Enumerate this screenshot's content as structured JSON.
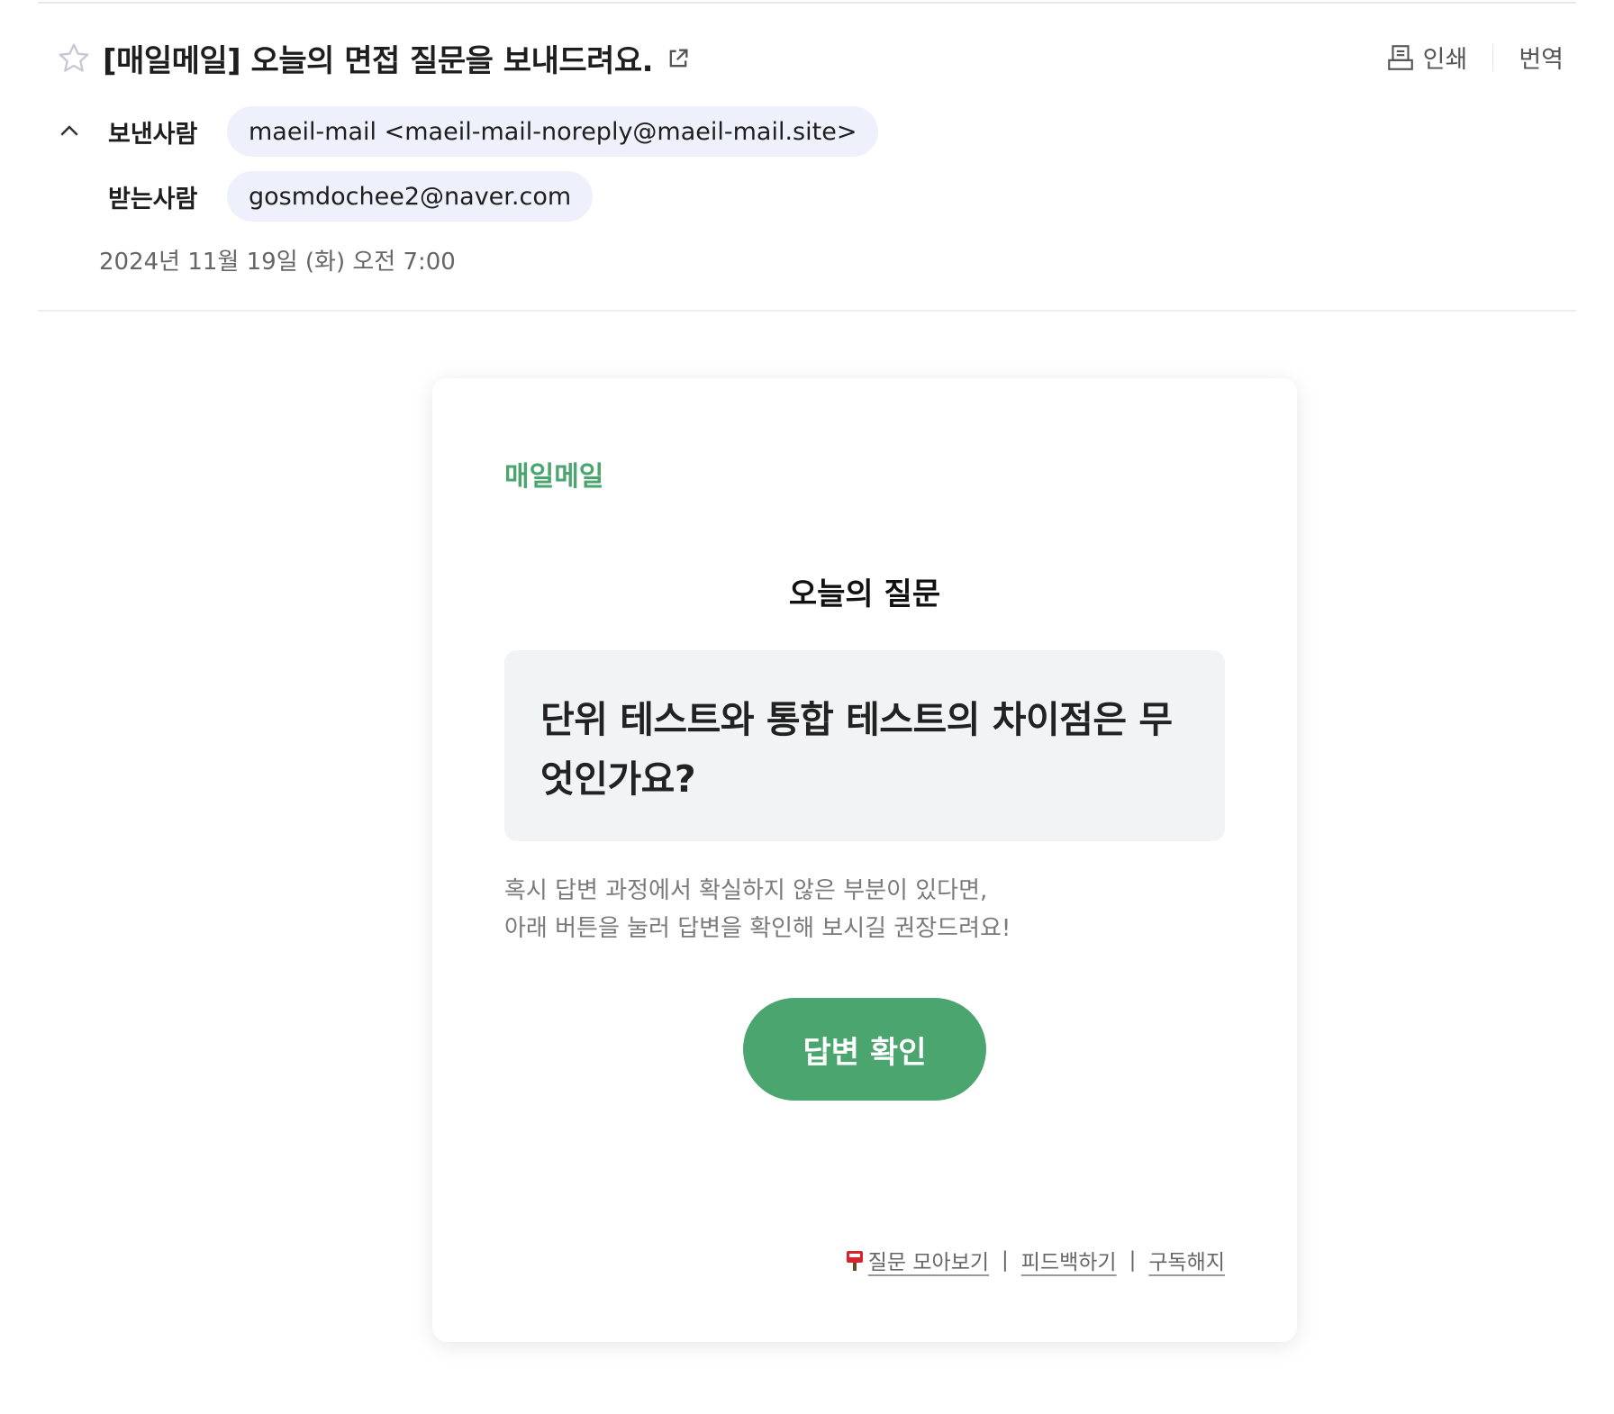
{
  "email": {
    "subject": "[매일메일] 오늘의 면접 질문을 보내드려요.",
    "actions": {
      "print_label": "인쇄",
      "translate_label": "번역"
    },
    "sender_label": "보낸사람",
    "sender": "maeil-mail <maeil-mail-noreply@maeil-mail.site>",
    "recipient_label": "받는사람",
    "recipient": "gosmdochee2@naver.com",
    "date": "2024년 11월 19일 (화) 오전 7:00"
  },
  "body": {
    "brand": "매일메일",
    "question_heading": "오늘의 질문",
    "question_line1": "단위 테스트와 통합 테스트의 차이점은 무",
    "question_line2": "엇인가요?",
    "desc_line1": "혹시 답변 과정에서 확실하지 않은 부분이 있다면,",
    "desc_line2": "아래 버튼을 눌러 답변을 확인해 보시길 권장드려요!",
    "cta_label": "답변 확인",
    "footer": {
      "collect_label": "질문 모아보기",
      "feedback_label": "피드백하기",
      "unsubscribe_label": "구독해지",
      "separator": "|"
    }
  },
  "colors": {
    "brand_green": "#4aa56f",
    "pill_bg": "#eef1fb",
    "question_bg": "#f2f3f5",
    "muted_text": "#7a7a7a"
  },
  "icons": [
    "star-icon",
    "external-link-icon",
    "printer-icon",
    "chevron-up-icon",
    "mailbox-icon"
  ]
}
